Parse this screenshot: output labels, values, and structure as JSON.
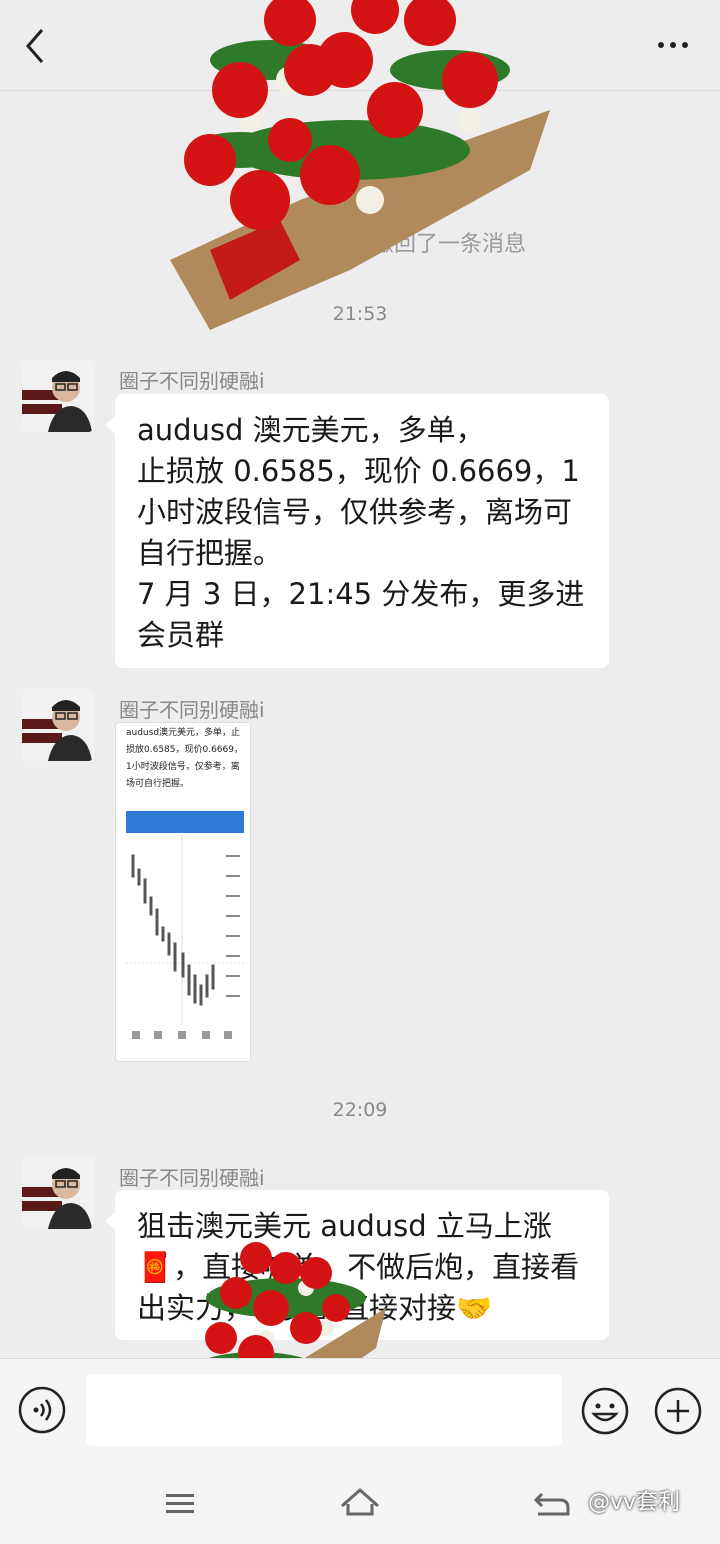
{
  "header": {
    "back_icon": "chevron-left-icon",
    "more_icon": "more-dots-icon"
  },
  "system": {
    "recalled_note": "撤回了一条消息"
  },
  "timestamps": [
    "21:53",
    "22:09"
  ],
  "messages": [
    {
      "sender": "圈子不同别硬融i",
      "text": "audusd 澳元美元，多单，\n止损放 0.6585，现价 0.6669，1 小时波段信号，仅供参考，离场可自行把握。\n7 月 3 日，21:45 分发布，更多进会员群"
    },
    {
      "sender": "圈子不同别硬融i",
      "image_text": "audusd澳元美元，多单，止损放0.6585，现价0.6669，1小时波段信号，仅参考，离场可自行把握。"
    },
    {
      "sender": "圈子不同别硬融i",
      "text": "狙击澳元美元 audusd 立马上涨🧧，直接喊单，不做后炮，直接看出实力，会员群直接对接🤝"
    }
  ],
  "input_bar": {
    "voice_icon": "voice-icon",
    "emoji_icon": "emoji-icon",
    "plus_icon": "plus-icon"
  },
  "nav": {
    "menu_icon": "menu-icon",
    "home_icon": "home-icon",
    "back_icon": "back-icon"
  },
  "watermark": "@vv套利",
  "colors": {
    "background": "#ededed",
    "bubble": "#ffffff",
    "meta_text": "#888888"
  }
}
